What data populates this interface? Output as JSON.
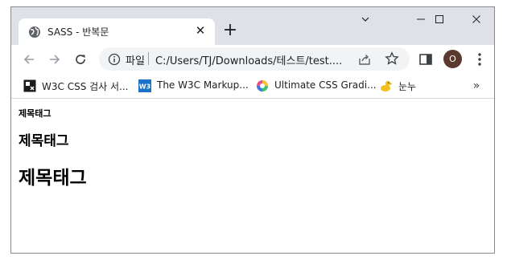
{
  "tab": {
    "title": "SASS - 반복문",
    "close_glyph": "✕",
    "favicon": "globe-icon"
  },
  "new_tab_glyph": "+",
  "window_controls": [
    "chevron-down-icon",
    "minimize-icon",
    "maximize-icon",
    "close-icon"
  ],
  "toolbar": {
    "back": "back-arrow-icon",
    "forward": "forward-arrow-icon",
    "reload": "reload-icon",
    "scheme_label": "파일",
    "url": "C:/Users/TJ/Downloads/테스트/test....",
    "avatar_letter": "O"
  },
  "bookmarks": [
    {
      "label": "W3C CSS 검사 서...",
      "icon": "w3c-validator-icon"
    },
    {
      "label": "The W3C Markup...",
      "icon": "w3-icon"
    },
    {
      "label": "Ultimate CSS Gradi...",
      "icon": "gradient-wheel-icon"
    },
    {
      "label": "눈누",
      "icon": "duck-icon"
    }
  ],
  "bookmarks_more": "»",
  "page": {
    "heading_small": "제목태그",
    "heading_mid": "제목태그",
    "heading_big": "제목태그"
  },
  "colors": {
    "titlebar": "#dee1e6",
    "omnibox": "#f1f3f4",
    "avatar": "#5a3a2e"
  }
}
